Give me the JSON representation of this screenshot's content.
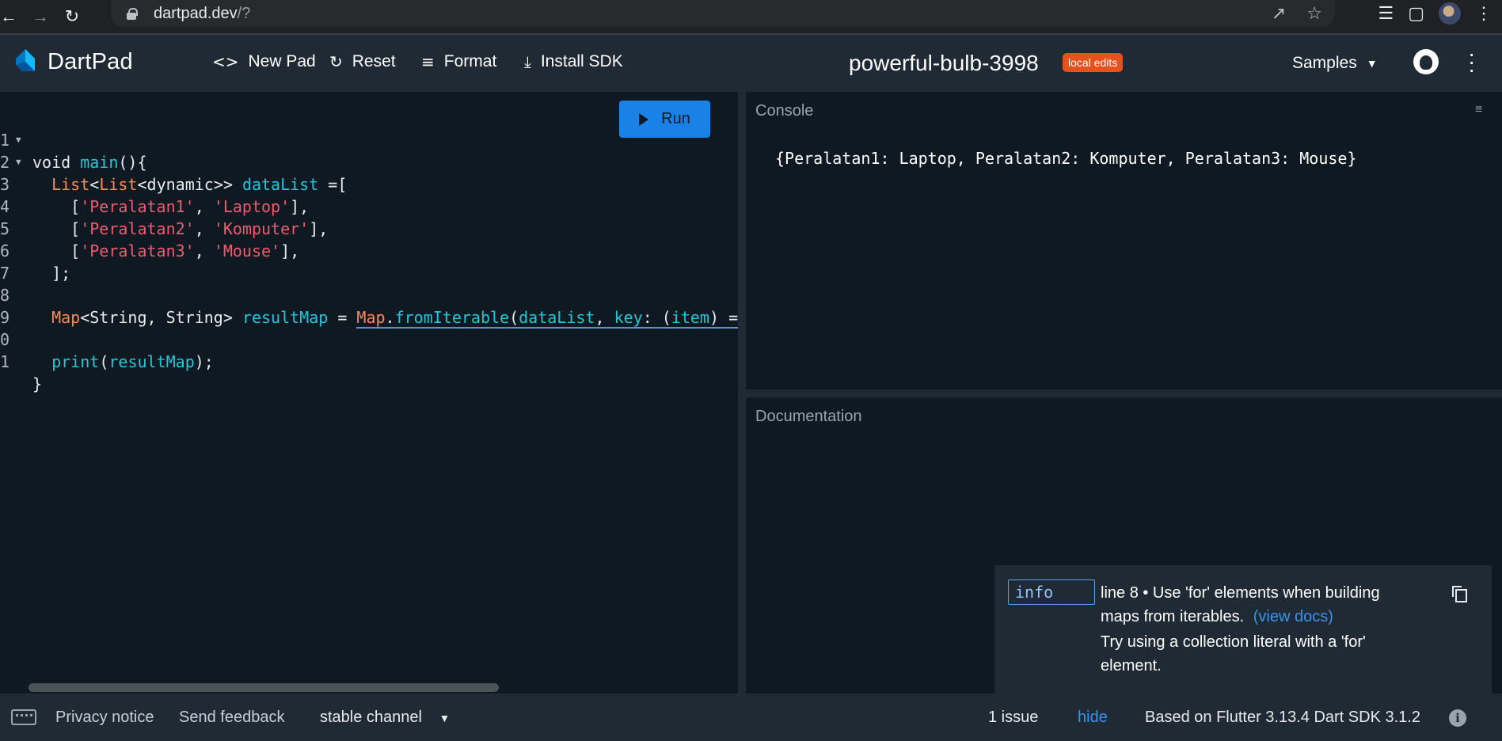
{
  "browser": {
    "url_host": "dartpad.dev",
    "url_path": "/?"
  },
  "appbar": {
    "app_name": "DartPad",
    "new_pad": "New Pad",
    "reset": "Reset",
    "format": "Format",
    "install_sdk": "Install SDK",
    "pad_title": "powerful-bulb-3998",
    "edit_badge": "local edits",
    "samples": "Samples"
  },
  "editor": {
    "run_label": "Run",
    "line_numbers": [
      "1",
      "2",
      "3",
      "4",
      "5",
      "6",
      "7",
      "8",
      "9",
      "0",
      "1"
    ]
  },
  "console": {
    "label": "Console",
    "output": "{Peralatan1: Laptop, Peralatan2: Komputer, Peralatan3: Mouse}"
  },
  "docs": {
    "label": "Documentation"
  },
  "issue": {
    "kind": "info",
    "message": "line 8 • Use 'for' elements when building maps from iterables.",
    "docs_link": "(view docs)",
    "fix": "Try using a collection literal with a 'for' element."
  },
  "status": {
    "privacy": "Privacy notice",
    "feedback": "Send feedback",
    "channel": "stable channel",
    "issues": "1 issue",
    "hide": "hide",
    "version": "Based on Flutter 3.13.4 Dart SDK 3.1.2"
  },
  "colors": {
    "background": "#0f1922",
    "bar": "#1f2a34",
    "run_button": "#1a82e6",
    "badge": "#e8501c",
    "link": "#3b92f0"
  }
}
